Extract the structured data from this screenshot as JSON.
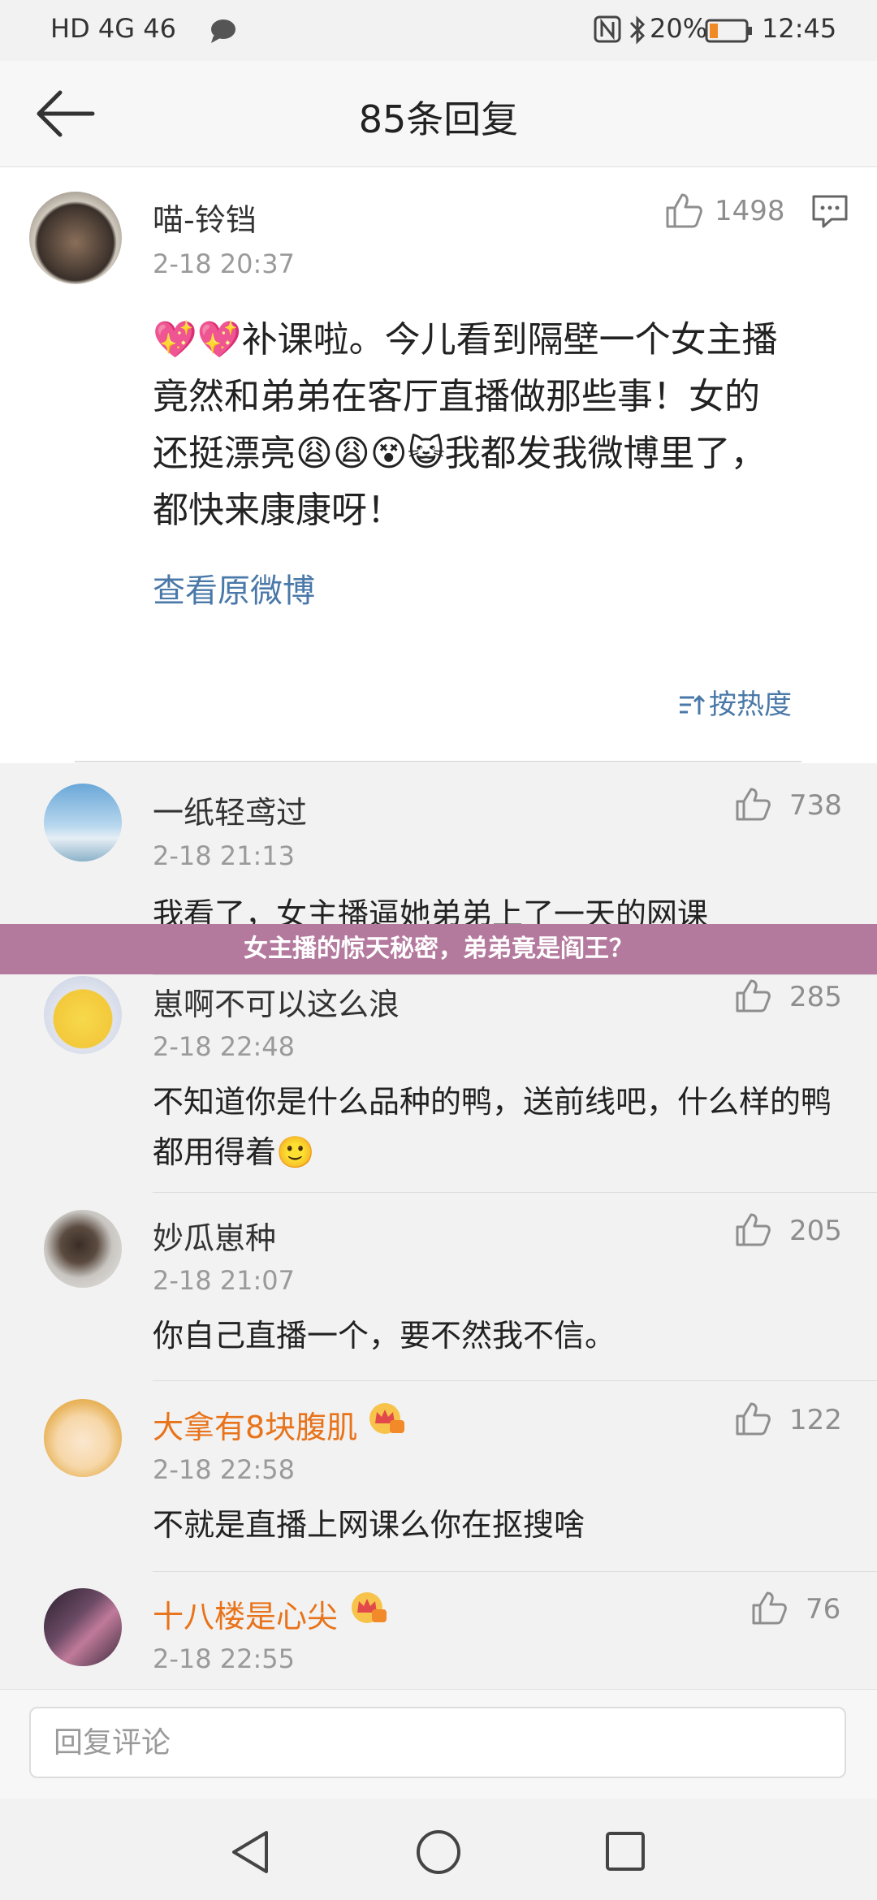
{
  "status_bar": {
    "left_signals": "HD 4G 46",
    "battery": "20%",
    "time": "12:45"
  },
  "header": {
    "title": "85条回复"
  },
  "main_comment": {
    "user": "喵-铃铛",
    "time": "2-18 20:37",
    "likes": "1498",
    "lines": [
      "💖💖补课啦。今儿看到隔壁一个女主播",
      "竟然和弟弟在客厅直播做那些事！女的",
      "还挺漂亮😩😩😵😺我都发我微博里了，",
      "都快来康康呀！"
    ],
    "link": "查看原微博",
    "sort_label": "按热度"
  },
  "banner": {
    "text": "女主播的惊天秘密，弟弟竟是阎王？"
  },
  "replies": [
    {
      "user": "一纸轻鸢过",
      "time": "2-18 21:13",
      "likes": "738",
      "text": "我看了，女主播逼她弟弟上了一天的网课",
      "vip": false
    },
    {
      "user": "崽啊不可以这么浪",
      "time": "2-18 22:48",
      "likes": "285",
      "text": "不知道你是什么品种的鸭，送前线吧，什么样的鸭都用得着🙂",
      "vip": false
    },
    {
      "user": "妙瓜崽种",
      "time": "2-18 21:07",
      "likes": "205",
      "text": "你自己直播一个，要不然我不信。",
      "vip": false
    },
    {
      "user": "大拿有8块腹肌",
      "time": "2-18 22:58",
      "likes": "122",
      "text": "不就是直播上网课么你在抠搜啥",
      "vip": true
    },
    {
      "user": "十八楼是心尖",
      "time": "2-18 22:55",
      "likes": "76",
      "text": "",
      "vip": true
    }
  ],
  "input": {
    "placeholder": "回复评论"
  },
  "colors": {
    "link_blue": "#4a78a8",
    "vip_orange": "#e8731a",
    "banner": "#b47a9e",
    "reply_bg": "#f2f2f2"
  }
}
